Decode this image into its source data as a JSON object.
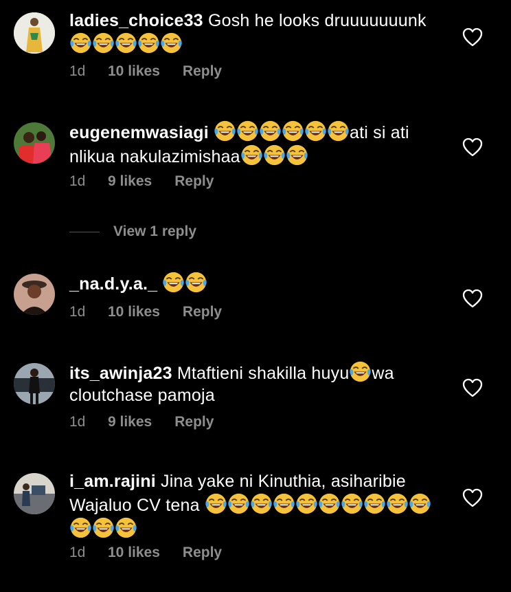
{
  "comments": [
    {
      "username": "ladies_choice33",
      "text": "Gosh he looks druuuuuuunk",
      "time": "1d",
      "likes": "10 likes",
      "reply": "Reply"
    },
    {
      "username": "eugenemwasiagi",
      "text": "ati si ati nlikua nakulazimishaa",
      "time": "1d",
      "likes": "9 likes",
      "reply": "Reply",
      "view_replies": "View 1 reply"
    },
    {
      "username": "_na.d.y.a._",
      "text": "",
      "time": "1d",
      "likes": "10 likes",
      "reply": "Reply"
    },
    {
      "username": "its_awinja23",
      "text_a": "Mtaftieni shakilla huyu",
      "text_b": "wa cloutchase pamoja",
      "time": "1d",
      "likes": "9 likes",
      "reply": "Reply"
    },
    {
      "username": "i_am.rajini",
      "text": "Jina yake ni Kinuthia, asiharibie Wajaluo CV tena",
      "time": "1d",
      "likes": "10 likes",
      "reply": "Reply"
    }
  ],
  "icons": {
    "emoji": "face-with-tears-of-joy-icon",
    "like": "heart-outline-icon"
  },
  "colors": {
    "background": "#000000",
    "text": "#ffffff",
    "meta": "#8e8e8e",
    "emoji_face": "#f5c33b",
    "emoji_tears": "#4aa8e8"
  }
}
